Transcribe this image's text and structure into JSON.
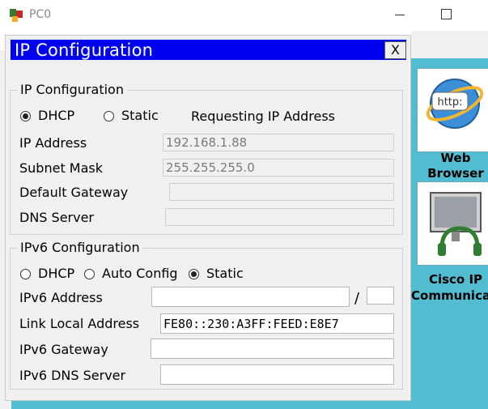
{
  "window": {
    "title": "PC0"
  },
  "dialog": {
    "title": "IP Configuration",
    "close_label": "X"
  },
  "ipv4": {
    "group_title": "IP Configuration",
    "mode_dhcp_label": "DHCP",
    "mode_static_label": "Static",
    "selected_mode": "DHCP",
    "status_text": "Requesting IP Address",
    "ip_address_label": "IP Address",
    "ip_address_value": "192.168.1.88",
    "subnet_mask_label": "Subnet Mask",
    "subnet_mask_value": "255.255.255.0",
    "gateway_label": "Default Gateway",
    "gateway_value": "",
    "dns_label": "DNS Server",
    "dns_value": ""
  },
  "ipv6": {
    "group_title": "IPv6 Configuration",
    "mode_dhcp_label": "DHCP",
    "mode_auto_label": "Auto Config",
    "mode_static_label": "Static",
    "selected_mode": "Static",
    "address_label": "IPv6 Address",
    "address_value": "",
    "prefix_separator": "/",
    "prefix_value": "",
    "link_local_label": "Link Local Address",
    "link_local_value": "FE80::230:A3FF:FEED:E8E7",
    "gateway_label": "IPv6 Gateway",
    "gateway_value": "",
    "dns_label": "IPv6 DNS Server",
    "dns_value": ""
  },
  "desktop": {
    "web_browser_line1": "Web",
    "web_browser_line2": "Browser",
    "ip_comm_line1": "Cisco IP",
    "ip_comm_line2": "Communicator",
    "http_badge": "http:"
  },
  "colors": {
    "dialog_title_bg": "#0000f0",
    "desktop_bg": "#52bcd0"
  }
}
